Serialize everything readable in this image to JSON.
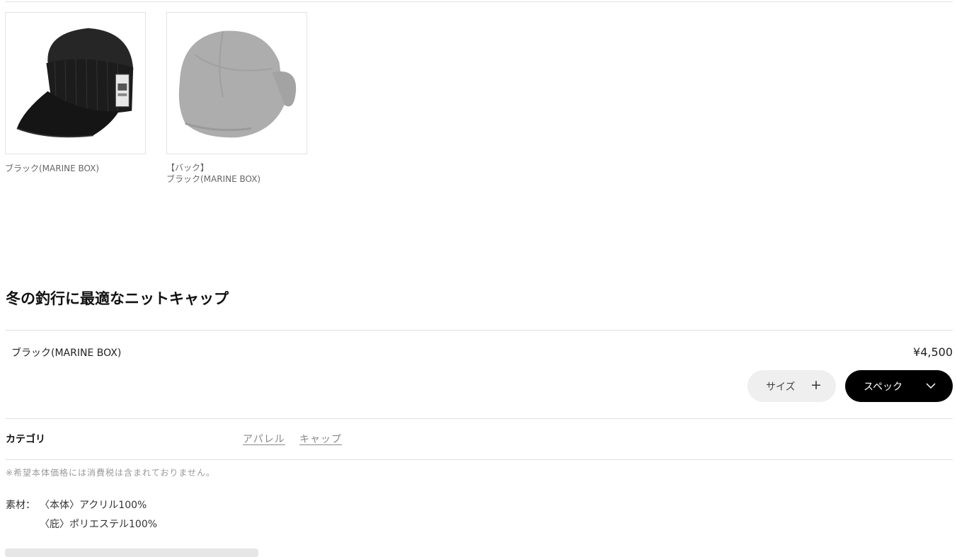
{
  "gallery": {
    "items": [
      {
        "caption_lines": [
          "ブラック(MARINE BOX)"
        ],
        "color": "#1f1f1f"
      },
      {
        "caption_lines": [
          "【バック】",
          "ブラック(MARINE BOX)"
        ],
        "color": "#b5b5b5"
      }
    ]
  },
  "product": {
    "title": "冬の釣行に最適なニットキャップ",
    "variant": "ブラック(MARINE BOX)",
    "price": "¥4,500"
  },
  "buttons": {
    "size_label": "サイズ",
    "size_icon": "+",
    "spec_label": "スペック"
  },
  "category": {
    "label": "カテゴリ",
    "links": [
      "アパレル",
      "キャップ"
    ]
  },
  "tax_note": "※希望本体価格には消費税は含まれておりません。",
  "material": {
    "label": "素材：",
    "lines": [
      "〈本体〉アクリル100%",
      "〈庇〉ポリエステル100%"
    ]
  },
  "colors": {
    "accent": "#000000",
    "secondary_button": "#efefef"
  }
}
